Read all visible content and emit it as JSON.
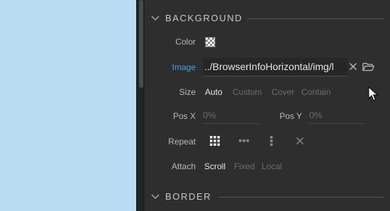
{
  "canvas": {
    "color": "#b9dcf3"
  },
  "sections": {
    "background": {
      "title": "BACKGROUND"
    },
    "border": {
      "title": "BORDER"
    }
  },
  "color_row": {
    "label": "Color",
    "swatch": "transparent-checker"
  },
  "image_row": {
    "label": "Image",
    "value": "../BrowserInfoHorizontal/img/l",
    "clear_icon": "close-icon",
    "browse_icon": "folder-open-icon"
  },
  "size_row": {
    "label": "Size",
    "options": [
      "Auto",
      "Custom",
      "Cover",
      "Contain"
    ],
    "selected": "Auto"
  },
  "pos_row": {
    "x_label": "Pos X",
    "x_placeholder": "0%",
    "y_label": "Pos Y",
    "y_placeholder": "0%"
  },
  "repeat_row": {
    "label": "Repeat",
    "options": [
      "repeat-both-icon",
      "repeat-x-icon",
      "repeat-y-icon",
      "no-repeat-icon"
    ],
    "selected": "repeat-both-icon"
  },
  "attach_row": {
    "label": "Attach",
    "options": [
      "Scroll",
      "Fixed",
      "Local"
    ],
    "selected": "Scroll"
  },
  "colors": {
    "accent": "#4a9fe0",
    "panel": "#2e2e2e",
    "canvas": "#b9dcf3"
  }
}
